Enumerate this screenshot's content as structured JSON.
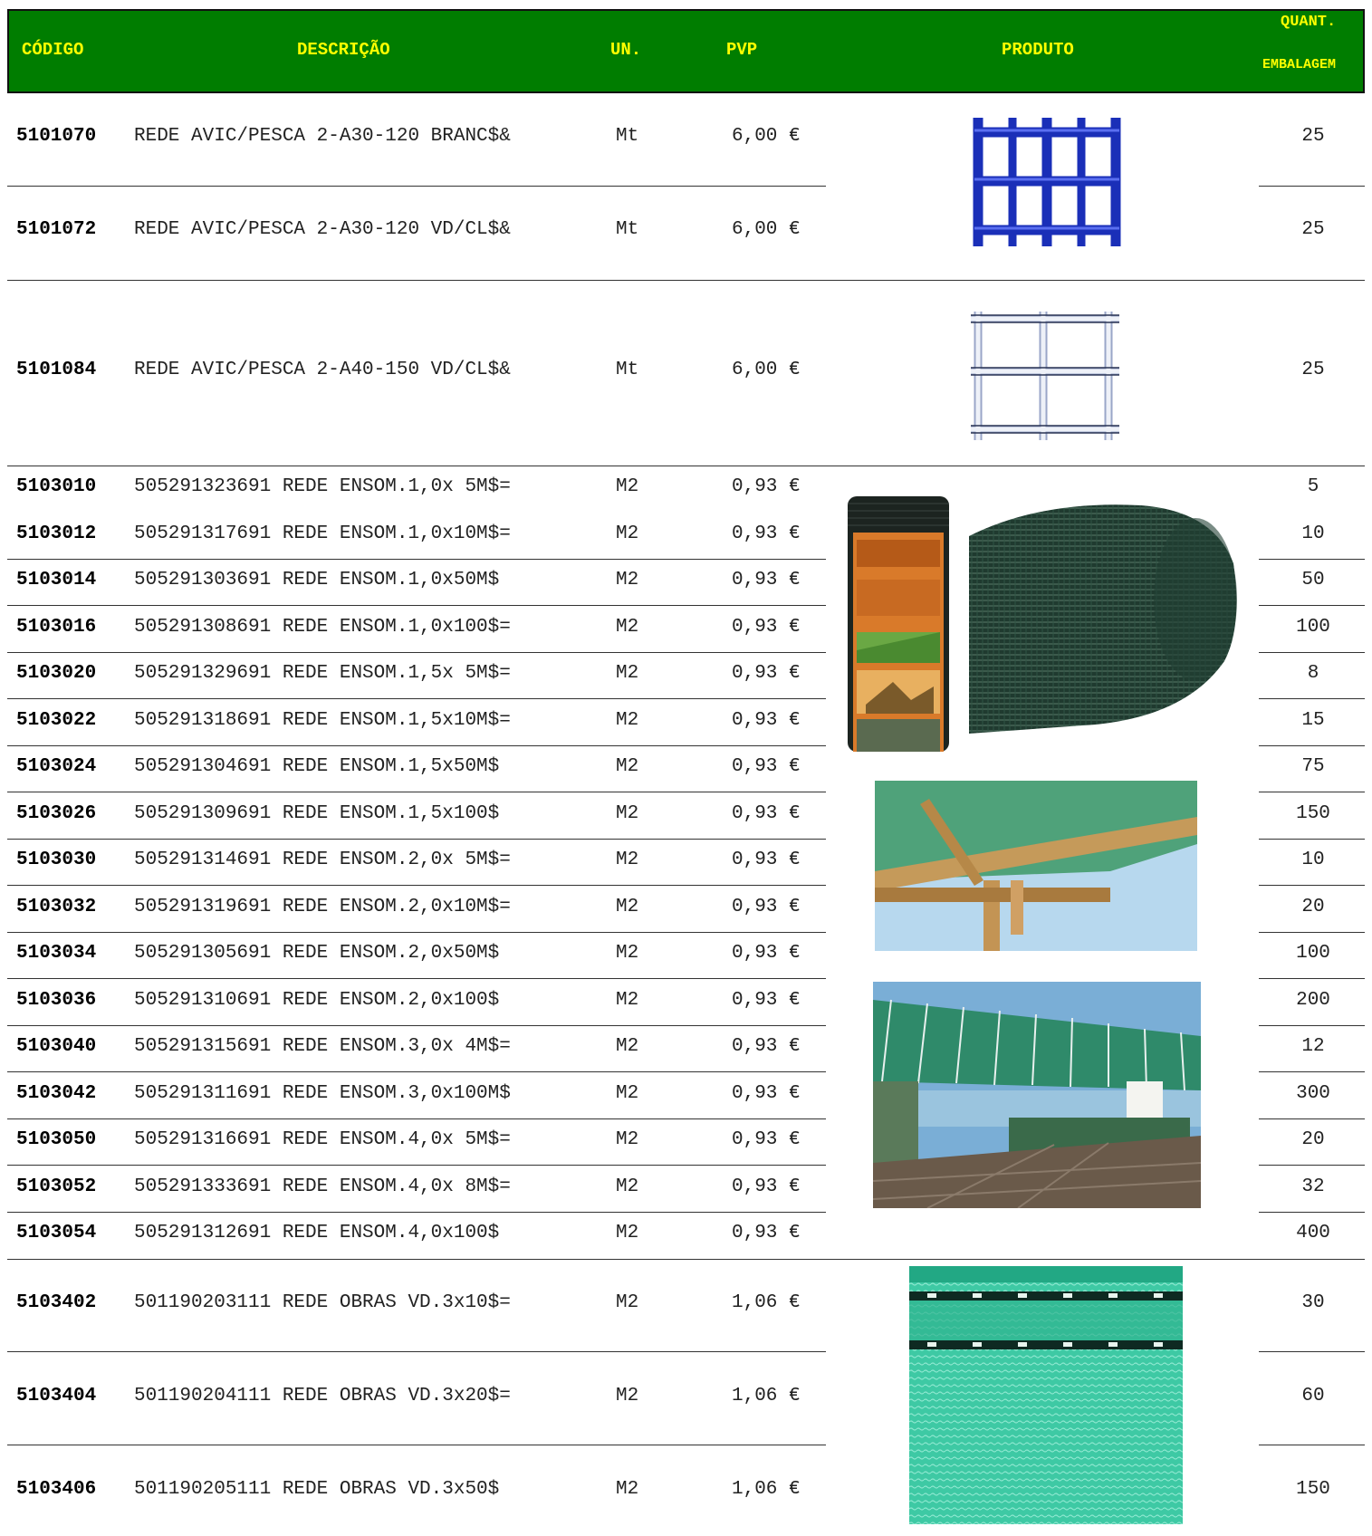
{
  "header": {
    "code": "CÓDIGO",
    "description": "DESCRIÇÃO",
    "unit": "UN.",
    "price": "PVP",
    "product": "PRODUTO",
    "qty_line1": "QUANT.",
    "qty_line2": "EMBALAGEM"
  },
  "colors": {
    "header_bg": "#007d00",
    "header_text": "#ffff00"
  },
  "rows": [
    {
      "code": "5101070",
      "description": "REDE AVIC/PESCA 2-A30-120 BRANC$&",
      "unit": "Mt",
      "price": "6,00 €",
      "qty": "25"
    },
    {
      "code": "5101072",
      "description": "REDE AVIC/PESCA 2-A30-120 VD/CL$&",
      "unit": "Mt",
      "price": "6,00 €",
      "qty": "25"
    },
    {
      "code": "5101084",
      "description": "REDE AVIC/PESCA 2-A40-150 VD/CL$&",
      "unit": "Mt",
      "price": "6,00 €",
      "qty": "25"
    },
    {
      "code": "5103010",
      "description": "505291323691 REDE ENSOM.1,0x 5M$=",
      "unit": "M2",
      "price": "0,93 €",
      "qty": "5"
    },
    {
      "code": "5103012",
      "description": "505291317691 REDE ENSOM.1,0x10M$=",
      "unit": "M2",
      "price": "0,93 €",
      "qty": "10"
    },
    {
      "code": "5103014",
      "description": "505291303691 REDE ENSOM.1,0x50M$",
      "unit": "M2",
      "price": "0,93 €",
      "qty": "50"
    },
    {
      "code": "5103016",
      "description": "505291308691 REDE ENSOM.1,0x100$=",
      "unit": "M2",
      "price": "0,93 €",
      "qty": "100"
    },
    {
      "code": "5103020",
      "description": "505291329691 REDE ENSOM.1,5x 5M$=",
      "unit": "M2",
      "price": "0,93 €",
      "qty": "8"
    },
    {
      "code": "5103022",
      "description": "505291318691 REDE ENSOM.1,5x10M$=",
      "unit": "M2",
      "price": "0,93 €",
      "qty": "15"
    },
    {
      "code": "5103024",
      "description": "505291304691 REDE ENSOM.1,5x50M$",
      "unit": "M2",
      "price": "0,93 €",
      "qty": "75"
    },
    {
      "code": "5103026",
      "description": "505291309691 REDE ENSOM.1,5x100$",
      "unit": "M2",
      "price": "0,93 €",
      "qty": "150"
    },
    {
      "code": "5103030",
      "description": "505291314691 REDE ENSOM.2,0x 5M$=",
      "unit": "M2",
      "price": "0,93 €",
      "qty": "10"
    },
    {
      "code": "5103032",
      "description": "505291319691 REDE ENSOM.2,0x10M$=",
      "unit": "M2",
      "price": "0,93 €",
      "qty": "20"
    },
    {
      "code": "5103034",
      "description": "505291305691 REDE ENSOM.2,0x50M$",
      "unit": "M2",
      "price": "0,93 €",
      "qty": "100"
    },
    {
      "code": "5103036",
      "description": "505291310691 REDE ENSOM.2,0x100$",
      "unit": "M2",
      "price": "0,93 €",
      "qty": "200"
    },
    {
      "code": "5103040",
      "description": "505291315691 REDE ENSOM.3,0x 4M$=",
      "unit": "M2",
      "price": "0,93 €",
      "qty": "12"
    },
    {
      "code": "5103042",
      "description": "505291311691 REDE ENSOM.3,0x100M$",
      "unit": "M2",
      "price": "0,93 €",
      "qty": "300"
    },
    {
      "code": "5103050",
      "description": "505291316691 REDE ENSOM.4,0x 5M$=",
      "unit": "M2",
      "price": "0,93 €",
      "qty": "20"
    },
    {
      "code": "5103052",
      "description": "505291333691 REDE ENSOM.4,0x 8M$=",
      "unit": "M2",
      "price": "0,93 €",
      "qty": "32"
    },
    {
      "code": "5103054",
      "description": "505291312691 REDE ENSOM.4,0x100$",
      "unit": "M2",
      "price": "0,93 €",
      "qty": "400"
    },
    {
      "code": "5103402",
      "description": "501190203111 REDE OBRAS VD.3x10$=",
      "unit": "M2",
      "price": "1,06 €",
      "qty": "30"
    },
    {
      "code": "5103404",
      "description": "501190204111 REDE OBRAS VD.3x20$=",
      "unit": "M2",
      "price": "1,06 €",
      "qty": "60"
    },
    {
      "code": "5103406",
      "description": "501190205111 REDE OBRAS VD.3x50$",
      "unit": "M2",
      "price": "1,06 €",
      "qty": "150"
    }
  ],
  "product_images": [
    {
      "icon": "blue-plastic-mesh-image"
    },
    {
      "icon": "clear-plastic-mesh-image"
    },
    {
      "icon": "shade-net-package-image"
    },
    {
      "icon": "shade-net-roll-image"
    },
    {
      "icon": "pergola-wood-shade-image"
    },
    {
      "icon": "pergola-terrace-shade-image"
    },
    {
      "icon": "construction-net-image"
    }
  ]
}
